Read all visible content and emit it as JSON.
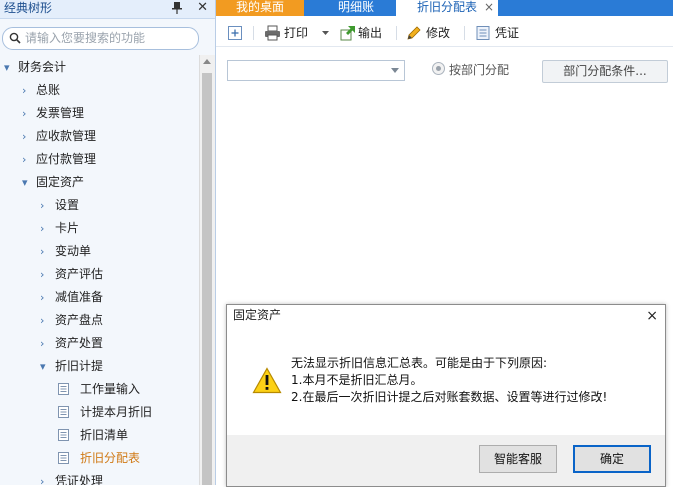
{
  "left_panel": {
    "title": "经典树形",
    "search_placeholder": "请输入您要搜索的功能",
    "tree": [
      {
        "label": "财务会计",
        "level": 0,
        "arrow": "▾"
      },
      {
        "label": "总账",
        "level": 1,
        "arrow": "›"
      },
      {
        "label": "发票管理",
        "level": 1,
        "arrow": "›"
      },
      {
        "label": "应收款管理",
        "level": 1,
        "arrow": "›"
      },
      {
        "label": "应付款管理",
        "level": 1,
        "arrow": "›"
      },
      {
        "label": "固定资产",
        "level": 1,
        "arrow": "▾"
      },
      {
        "label": "设置",
        "level": 2,
        "arrow": "›"
      },
      {
        "label": "卡片",
        "level": 2,
        "arrow": "›"
      },
      {
        "label": "变动单",
        "level": 2,
        "arrow": "›"
      },
      {
        "label": "资产评估",
        "level": 2,
        "arrow": "›"
      },
      {
        "label": "减值准备",
        "level": 2,
        "arrow": "›"
      },
      {
        "label": "资产盘点",
        "level": 2,
        "arrow": "›"
      },
      {
        "label": "资产处置",
        "level": 2,
        "arrow": "›"
      },
      {
        "label": "折旧计提",
        "level": 2,
        "arrow": "▾"
      },
      {
        "label": "工作量输入",
        "level": 3
      },
      {
        "label": "计提本月折旧",
        "level": 3
      },
      {
        "label": "折旧清单",
        "level": 3
      },
      {
        "label": "折旧分配表",
        "level": 3,
        "active": true
      },
      {
        "label": "凭证处理",
        "level": 2,
        "arrow": "›"
      }
    ]
  },
  "tabs": [
    {
      "label": "我的桌面"
    },
    {
      "label": "明细账"
    },
    {
      "label": "折旧分配表",
      "close": "×"
    }
  ],
  "toolbar": {
    "print": "打印",
    "export": "输出",
    "modify": "修改",
    "voucher": "凭证"
  },
  "filter": {
    "combo_value": "",
    "radio_label": "按部门分配",
    "dept_button": "部门分配条件..."
  },
  "dialog": {
    "title": "固定资产",
    "close": "×",
    "lines": [
      "无法显示折旧信息汇总表。可能是由于下列原因:",
      "1.本月不是折旧汇总月。",
      "2.在最后一次折旧计提之后对账套数据、设置等进行过修改!"
    ],
    "help_button": "智能客服",
    "ok_button": "确定"
  },
  "colors": {
    "active_tab": "#f29b21",
    "tab_bar": "#2a7bd6",
    "active_tree_item": "#d07a16"
  }
}
